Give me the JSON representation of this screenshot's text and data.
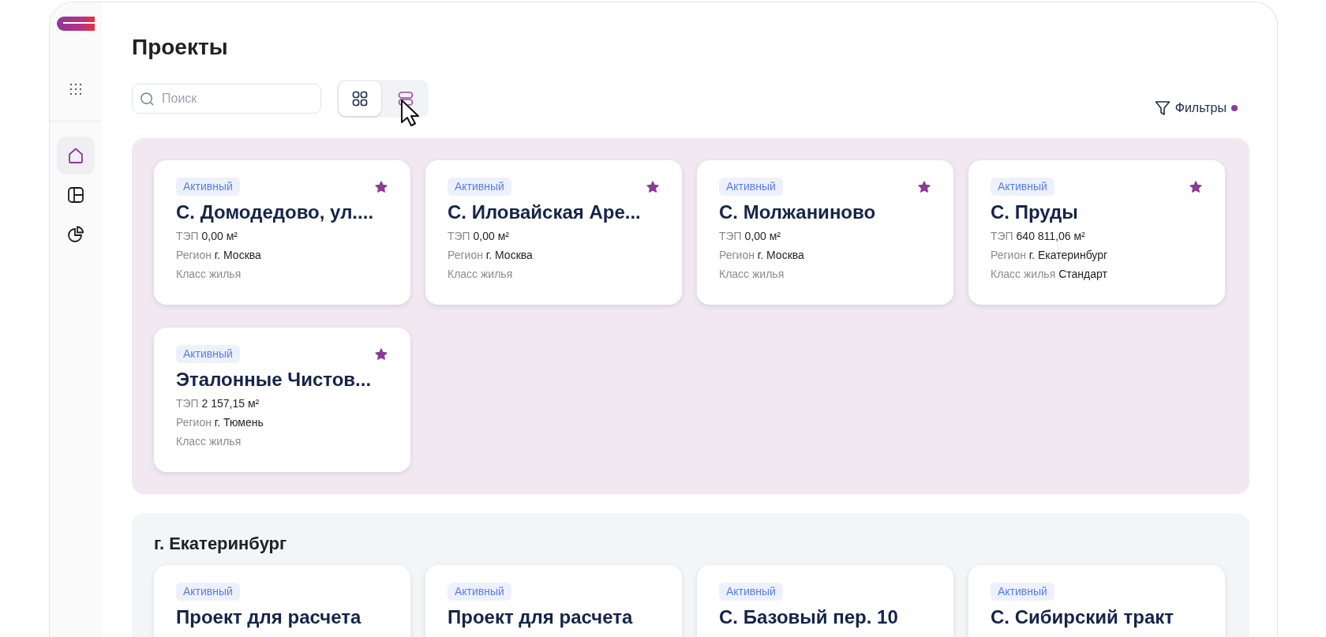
{
  "sidebar": {
    "nav": [
      {
        "kind": "home",
        "selected": true
      },
      {
        "kind": "layout",
        "selected": false
      },
      {
        "kind": "chart",
        "selected": false
      }
    ]
  },
  "title": "Проекты",
  "toolbar": {
    "search": {
      "placeholder": "Поиск"
    },
    "views": [
      {
        "kind": "grid",
        "selected": true
      },
      {
        "kind": "list",
        "selected": false
      }
    ],
    "filters": {
      "label": "Фильтры",
      "active": true
    }
  },
  "groups": [
    {
      "highlighted": true,
      "cards": [
        {
          "status": "Активный",
          "favorite": true,
          "title": "С. Домодедово, ул....",
          "fields": [
            {
              "label": "ТЭП",
              "value": "0,00 м²"
            },
            {
              "label": "Регион",
              "value": "г. Москва"
            },
            {
              "label": "Класс жилья"
            }
          ]
        },
        {
          "status": "Активный",
          "favorite": true,
          "title": "С. Иловайская Аре...",
          "fields": [
            {
              "label": "ТЭП",
              "value": "0,00 м²"
            },
            {
              "label": "Регион",
              "value": "г. Москва"
            },
            {
              "label": "Класс жилья"
            }
          ]
        },
        {
          "status": "Активный",
          "favorite": true,
          "title": "С. Молжаниново",
          "fields": [
            {
              "label": "ТЭП",
              "value": "0,00 м²"
            },
            {
              "label": "Регион",
              "value": "г. Москва"
            },
            {
              "label": "Класс жилья"
            }
          ]
        },
        {
          "status": "Активный",
          "favorite": true,
          "title": "С. Пруды",
          "fields": [
            {
              "label": "ТЭП",
              "value": "640 811,06 м²"
            },
            {
              "label": "Регион",
              "value": "г. Екатеринбург"
            },
            {
              "label": "Класс жилья",
              "value": "Стандарт"
            }
          ]
        },
        {
          "status": "Активный",
          "favorite": true,
          "title": "Эталонные Чистов...",
          "fields": [
            {
              "label": "ТЭП",
              "value": "2 157,15 м²"
            },
            {
              "label": "Регион",
              "value": "г. Тюмень"
            },
            {
              "label": "Класс жилья"
            }
          ]
        }
      ]
    },
    {
      "highlighted": false,
      "title": "г. Екатеринбург",
      "cards": [
        {
          "status": "Активный",
          "title": "Проект для расчета"
        },
        {
          "status": "Активный",
          "title": "Проект для расчета"
        },
        {
          "status": "Активный",
          "title": "С. Базовый пер. 10"
        },
        {
          "status": "Активный",
          "title": "С. Сибирский тракт"
        }
      ]
    }
  ]
}
